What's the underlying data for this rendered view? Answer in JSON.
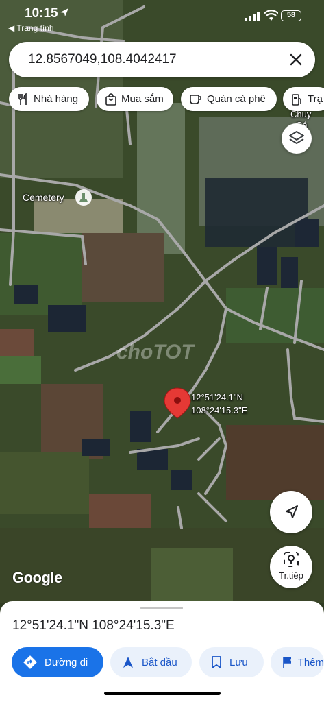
{
  "status_bar": {
    "time": "10:15",
    "back_label": "◀ Trang tính",
    "battery": "58"
  },
  "search": {
    "query": "12.8567049,108.4042417"
  },
  "chips": [
    {
      "label": "Nhà hàng",
      "icon": "restaurant-icon"
    },
    {
      "label": "Mua sắm",
      "icon": "shopping-bag-icon"
    },
    {
      "label": "Quán cà phê",
      "icon": "coffee-icon"
    },
    {
      "label": "Trạ",
      "icon": "gas-station-icon"
    }
  ],
  "map": {
    "labels": {
      "cemetery": "Cemetery",
      "partial_top": "Chuy",
      "partial_bottom": "Cá"
    },
    "pin_label_line1": "12°51'24.1\"N",
    "pin_label_line2": "108°24'15.3\"E",
    "watermark": "choTOT",
    "attribution": "Google",
    "directions_fab_label": "Tr.tiếp",
    "colors": {
      "pin": "#e53935",
      "road": "#a8a8a8"
    }
  },
  "sheet": {
    "title": "12°51'24.1\"N 108°24'15.3\"E",
    "actions": [
      {
        "label": "Đường đi",
        "icon": "directions-icon"
      },
      {
        "label": "Bắt đầu",
        "icon": "navigation-icon"
      },
      {
        "label": "Lưu",
        "icon": "bookmark-icon"
      },
      {
        "label": "Thêm",
        "icon": "flag-icon"
      }
    ],
    "accent": "#1a73e8"
  }
}
